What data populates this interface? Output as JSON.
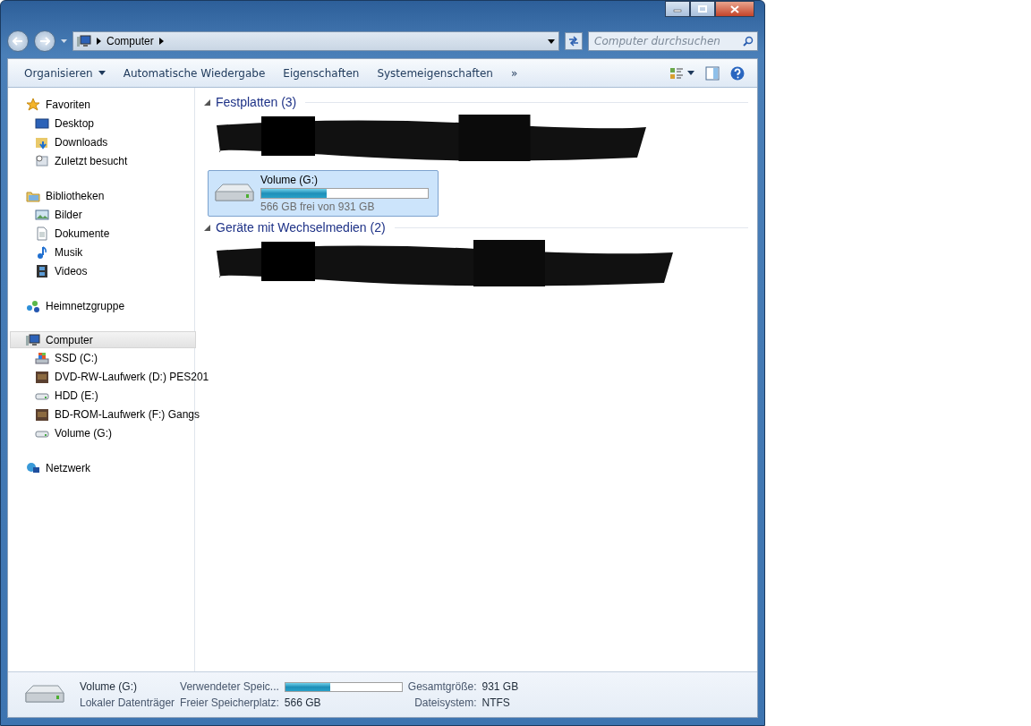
{
  "address_bar": {
    "path": [
      "Computer"
    ],
    "search_placeholder": "Computer durchsuchen"
  },
  "toolbar": {
    "items": [
      "Organisieren",
      "Automatische Wiedergabe",
      "Eigenschaften",
      "Systemeigenschaften"
    ],
    "more": "»"
  },
  "sidebar": {
    "groups": [
      {
        "label": "Favoriten",
        "kind": "star",
        "selected": false,
        "children": [
          {
            "label": "Desktop",
            "kind": "desktop"
          },
          {
            "label": "Downloads",
            "kind": "download"
          },
          {
            "label": "Zuletzt besucht",
            "kind": "recent"
          }
        ]
      },
      {
        "label": "Bibliotheken",
        "kind": "library",
        "selected": false,
        "children": [
          {
            "label": "Bilder",
            "kind": "picture"
          },
          {
            "label": "Dokumente",
            "kind": "document"
          },
          {
            "label": "Musik",
            "kind": "music"
          },
          {
            "label": "Videos",
            "kind": "film"
          }
        ]
      },
      {
        "label": "Heimnetzgruppe",
        "kind": "homegroup",
        "selected": false
      },
      {
        "label": "Computer",
        "kind": "computer",
        "selected": true,
        "children": [
          {
            "label": "SSD (C:)",
            "kind": "windrive"
          },
          {
            "label": "DVD-RW-Laufwerk (D:) PES201",
            "kind": "disc"
          },
          {
            "label": "HDD (E:)",
            "kind": "drive"
          },
          {
            "label": "BD-ROM-Laufwerk (F:) Gangs",
            "kind": "disc"
          },
          {
            "label": "Volume (G:)",
            "kind": "drive"
          }
        ]
      },
      {
        "label": "Netzwerk",
        "kind": "network",
        "selected": false
      }
    ]
  },
  "sections": [
    {
      "title": "Festplatten (3)",
      "drives": [
        {
          "name": "Volume (G:)",
          "level": 0.39,
          "caption": "566 GB frei von 931 GB",
          "selected": true
        }
      ]
    },
    {
      "title": "Geräte mit Wechselmedien (2)"
    }
  ],
  "details": {
    "name": "Volume (G:)",
    "type": "Lokaler Datenträger",
    "used_label": "Verwendeter Speic...",
    "level": 0.39,
    "free_label": "Freier Speicherplatz:",
    "free_value": "566 GB",
    "total_label": "Gesamtgröße:",
    "total_value": "931 GB",
    "fs_label": "Dateisystem:",
    "fs_value": "NTFS"
  }
}
